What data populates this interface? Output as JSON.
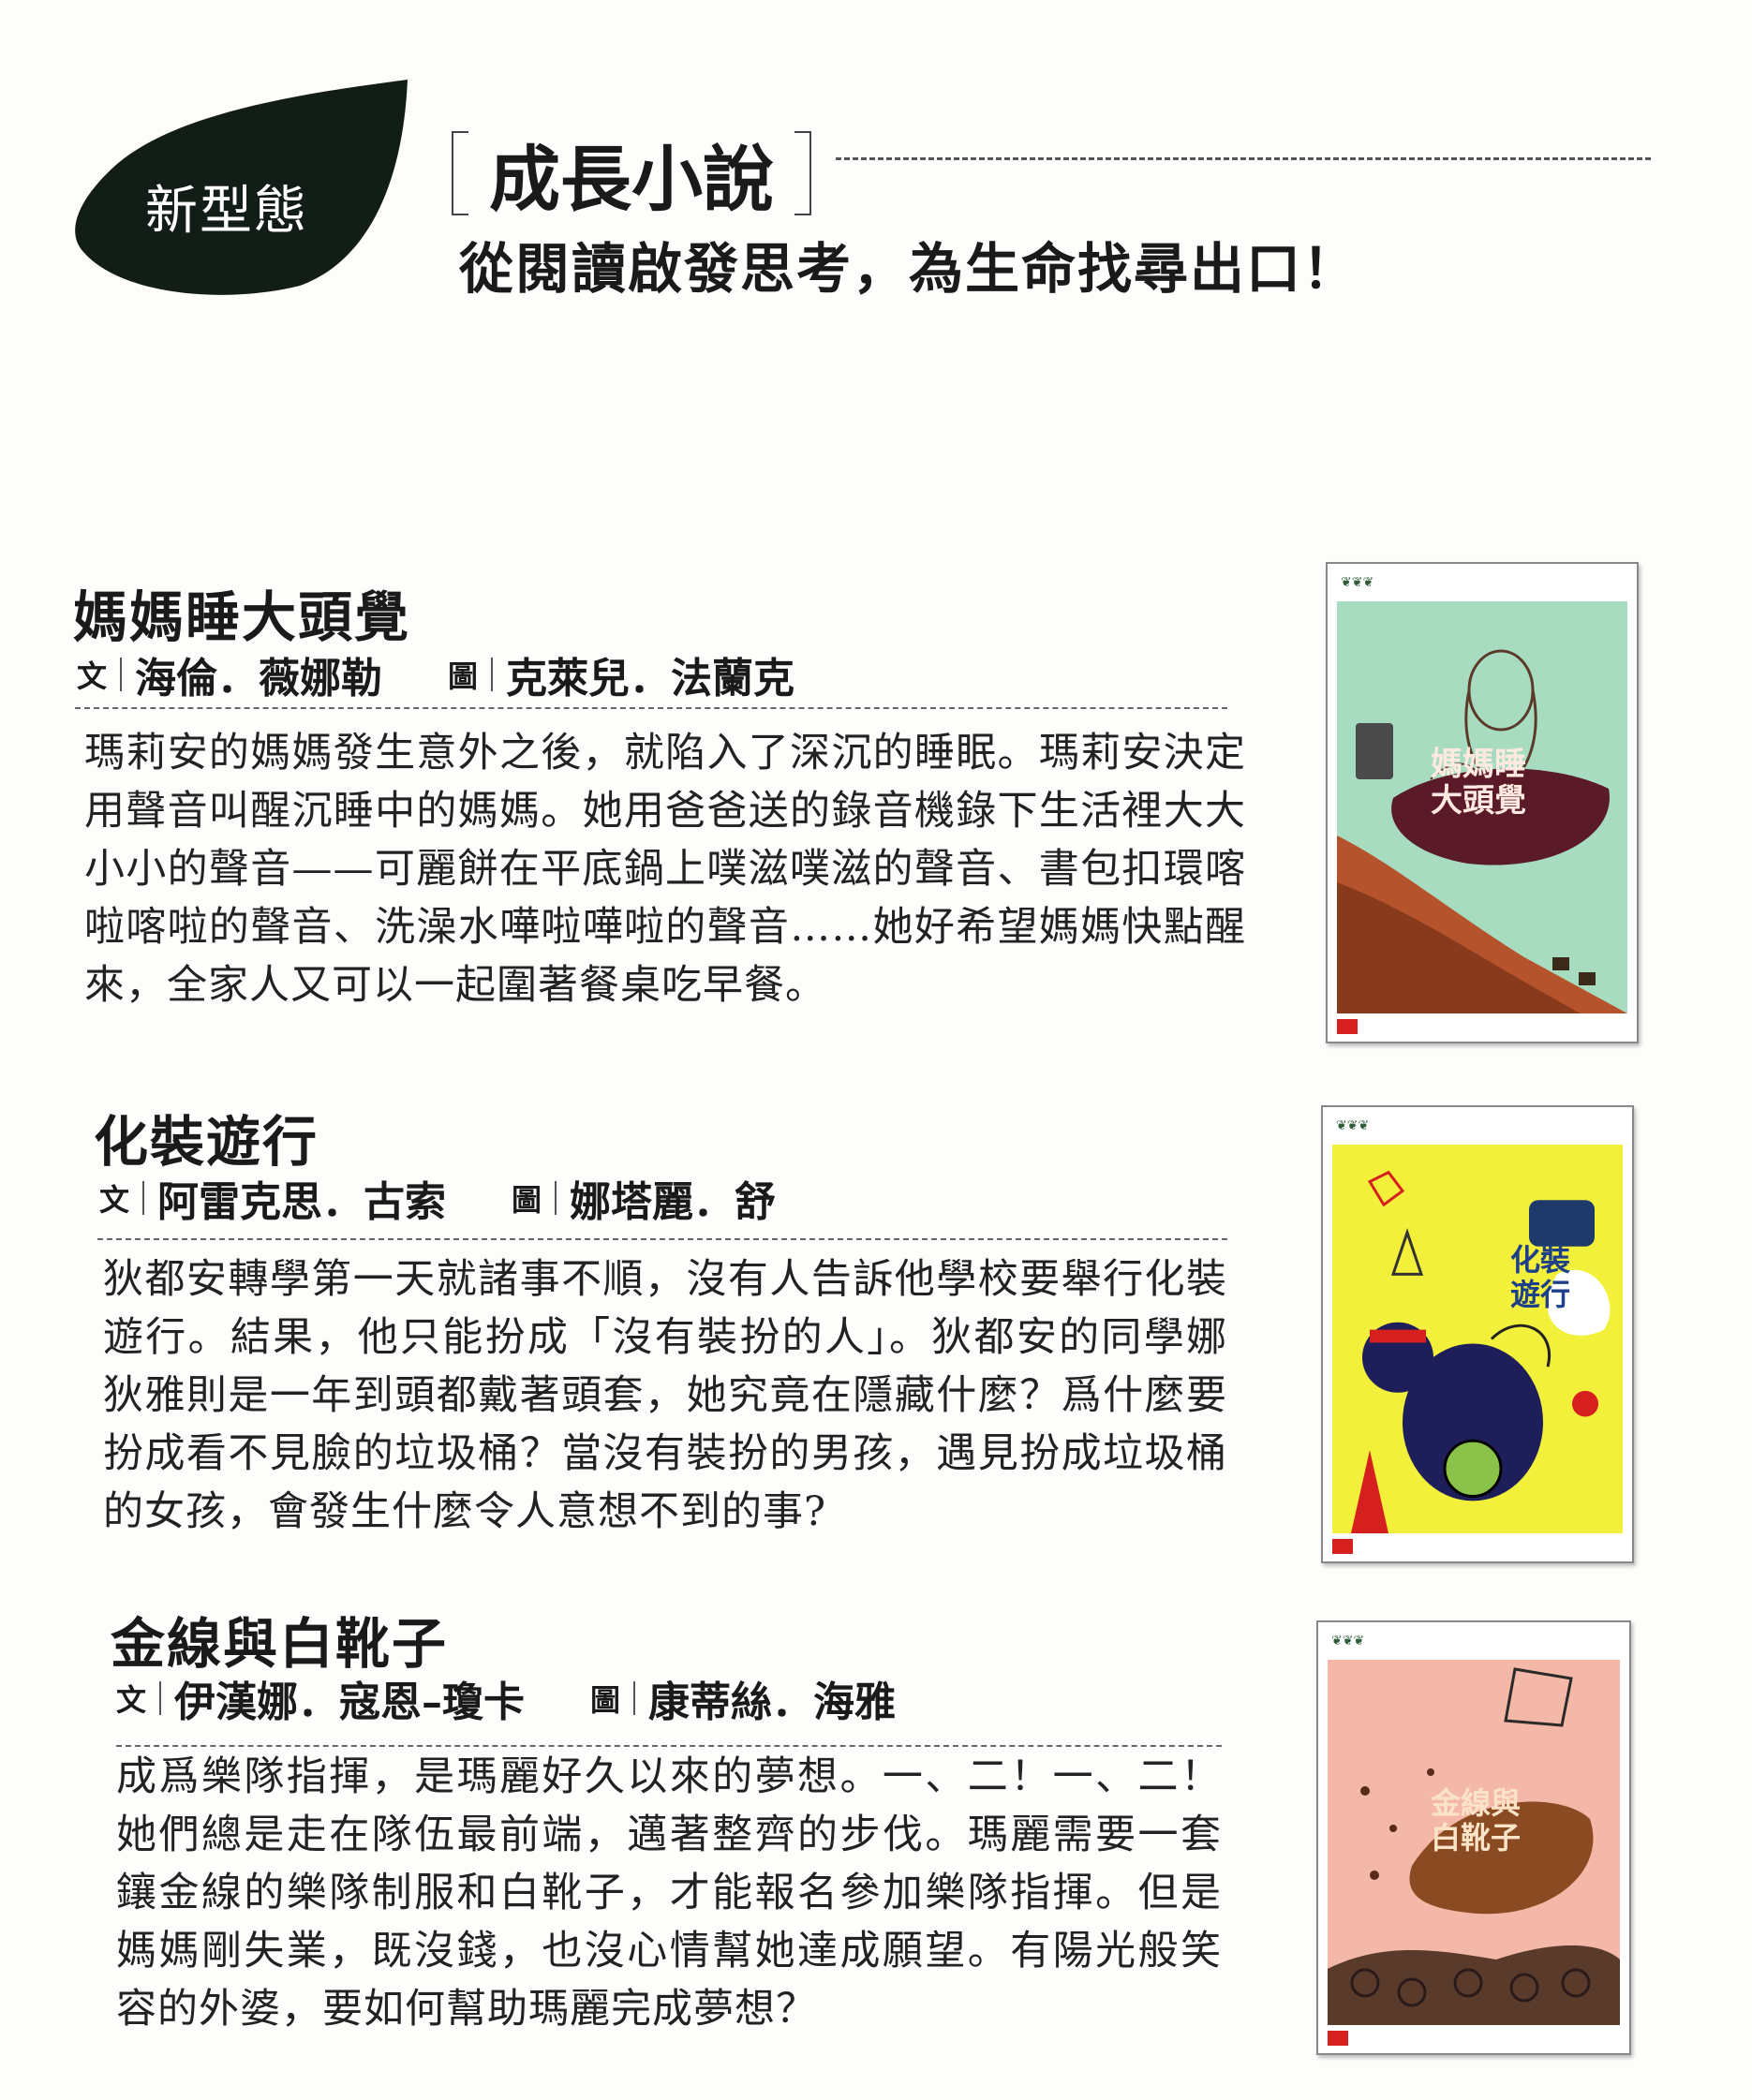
{
  "header": {
    "badge_label": "新型態",
    "title": "成長小說",
    "subtitle": "從閱讀啟發思考，為生命找尋出口！",
    "badge_color": "#131d17"
  },
  "books": [
    {
      "title": "媽媽睡大頭覺",
      "author_role": "文",
      "author": "海倫．薇娜勒",
      "illustrator_role": "圖",
      "illustrator": "克萊兒．法蘭克",
      "description": "瑪莉安的媽媽發生意外之後，就陷入了深沉的睡眠。瑪莉安決定用聲音叫醒沉睡中的媽媽。她用爸爸送的錄音機錄下生活裡大大小小的聲音——可麗餅在平底鍋上噗滋噗滋的聲音、書包扣環喀啦喀啦的聲音、洗澡水嘩啦嘩啦的聲音……她好希望媽媽快點醒來，全家人又可以一起圍著餐桌吃早餐。",
      "cover_title_line1": "媽媽睡",
      "cover_title_line2": "大頭覺",
      "cover_bg": "#a8dcc0"
    },
    {
      "title": "化裝遊行",
      "author_role": "文",
      "author": "阿雷克思．古索",
      "illustrator_role": "圖",
      "illustrator": "娜塔麗．舒",
      "description": "狄都安轉學第一天就諸事不順，沒有人告訴他學校要舉行化裝遊行。結果，他只能扮成「沒有裝扮的人」。狄都安的同學娜狄雅則是一年到頭都戴著頭套，她究竟在隱藏什麼？爲什麼要扮成看不見臉的垃圾桶？當沒有裝扮的男孩，遇見扮成垃圾桶的女孩，會發生什麼令人意想不到的事?",
      "cover_title_line1": "化裝",
      "cover_title_line2": "遊行",
      "cover_bg": "#f2f03a"
    },
    {
      "title": "金線與白靴子",
      "author_role": "文",
      "author": "伊漢娜．寇恩–瓊卡",
      "illustrator_role": "圖",
      "illustrator": "康蒂絲．海雅",
      "description": "成爲樂隊指揮，是瑪麗好久以來的夢想。一、二！一、二！她們總是走在隊伍最前端，邁著整齊的步伐。瑪麗需要一套鑲金線的樂隊制服和白靴子，才能報名參加樂隊指揮。但是媽媽剛失業，既沒錢，也沒心情幫她達成願望。有陽光般笑容的外婆，要如何幫助瑪麗完成夢想？",
      "cover_title_line1": "金線與",
      "cover_title_line2": "白靴子",
      "cover_bg": "#f4b8a8"
    }
  ]
}
